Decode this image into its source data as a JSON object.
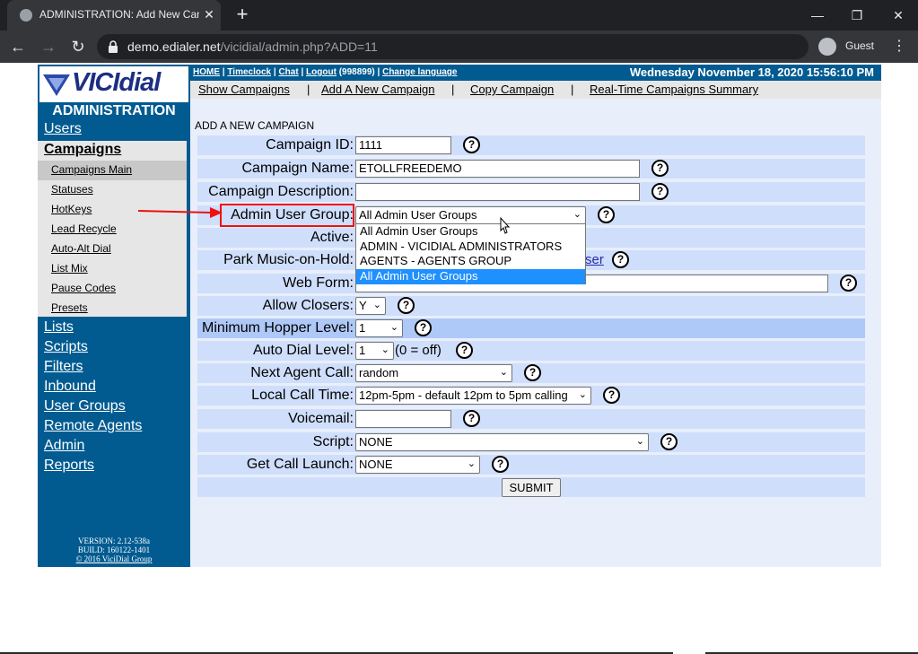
{
  "browser": {
    "tab_title": "ADMINISTRATION: Add New Campaign",
    "url_host": "demo.edialer.net",
    "url_path": "/vicidial/admin.php?ADD=11",
    "profile_label": "Guest"
  },
  "header": {
    "links": [
      "HOME",
      "Timeclock",
      "Chat",
      "Logout",
      "(998899)",
      "Change language"
    ],
    "datetime": "Wednesday November 18, 2020 15:56:10 PM"
  },
  "subnav": [
    "Show Campaigns",
    "Add A New Campaign",
    "Copy Campaign",
    "Real-Time Campaigns Summary"
  ],
  "sidebar": {
    "logo_text": "VICIdial",
    "title": "ADMINISTRATION",
    "items": [
      "Users",
      "Campaigns",
      "Lists",
      "Scripts",
      "Filters",
      "Inbound",
      "User Groups",
      "Remote Agents",
      "Admin",
      "Reports"
    ],
    "campaign_subitems": [
      "Campaigns Main",
      "Statuses",
      "HotKeys",
      "Lead Recycle",
      "Auto-Alt Dial",
      "List Mix",
      "Pause Codes",
      "Presets"
    ],
    "version": "VERSION: 2.12-538a",
    "build": "BUILD: 160122-1401",
    "copyright": "© 2016 ViciDial Group"
  },
  "form": {
    "section_title": "ADD A NEW CAMPAIGN",
    "campaign_id": {
      "label": "Campaign ID:",
      "value": "1111"
    },
    "campaign_name": {
      "label": "Campaign Name:",
      "value": "ETOLLFREEDEMO"
    },
    "campaign_description": {
      "label": "Campaign Description:",
      "value": ""
    },
    "admin_user_group": {
      "label": "Admin User Group:",
      "value": "All Admin User Groups"
    },
    "active": {
      "label": "Active:"
    },
    "park_music": {
      "label": "Park Music-on-Hold:",
      "link_fragment": "ser"
    },
    "web_form": {
      "label": "Web Form:",
      "value": ""
    },
    "allow_closers": {
      "label": "Allow Closers:",
      "value": "Y"
    },
    "minimum_hopper_level": {
      "label": "Minimum Hopper Level:",
      "value": "1"
    },
    "auto_dial_level": {
      "label": "Auto Dial Level:",
      "value": "1",
      "note": "(0 = off)"
    },
    "next_agent_call": {
      "label": "Next Agent Call:",
      "value": "random"
    },
    "local_call_time": {
      "label": "Local Call Time:",
      "value": "12pm-5pm - default 12pm to 5pm calling"
    },
    "voicemail": {
      "label": "Voicemail:",
      "value": ""
    },
    "script": {
      "label": "Script:",
      "value": "NONE"
    },
    "get_call_launch": {
      "label": "Get Call Launch:",
      "value": "NONE"
    },
    "submit_label": "SUBMIT",
    "help_glyph": "?"
  },
  "dropdown": {
    "options": [
      "All Admin User Groups",
      "ADMIN - VICIDIAL ADMINISTRATORS",
      "AGENTS - AGENTS GROUP",
      "All Admin User Groups"
    ],
    "selected_index": 3
  },
  "colors": {
    "brand_blue": "#015b91",
    "row_light": "#cfdefb",
    "row_dark": "#aec8f7",
    "annotation_red": "#e11"
  }
}
